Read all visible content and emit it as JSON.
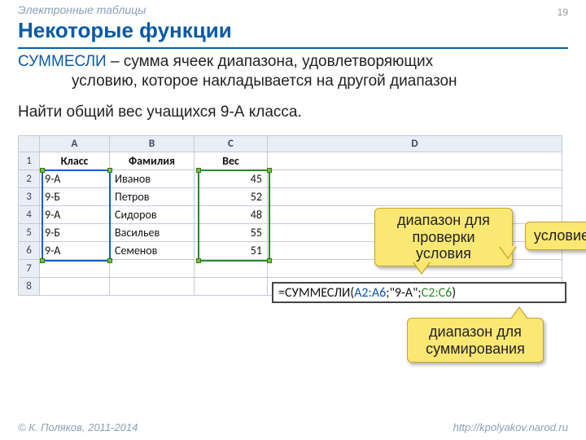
{
  "header": {
    "section": "Электронные таблицы",
    "page": "19"
  },
  "title": "Некоторые функции",
  "para1": {
    "func": "СУММЕСЛИ",
    "rest_line1": " – сумма ячеек диапазона, удовлетворяющих",
    "line2": "условию, которое накладывается на другой диапазон"
  },
  "para2": "Найти общий вес учащихся 9-А класса.",
  "spreadsheet": {
    "columns": [
      "A",
      "B",
      "C",
      "D"
    ],
    "headers": {
      "A": "Класс",
      "B": "Фамилия",
      "C": "Вес"
    },
    "rows": [
      {
        "n": "1"
      },
      {
        "n": "2",
        "A": "9-А",
        "B": "Иванов",
        "C": "45"
      },
      {
        "n": "3",
        "A": "9-Б",
        "B": "Петров",
        "C": "52"
      },
      {
        "n": "4",
        "A": "9-А",
        "B": "Сидоров",
        "C": "48"
      },
      {
        "n": "5",
        "A": "9-Б",
        "B": "Васильев",
        "C": "55"
      },
      {
        "n": "6",
        "A": "9-А",
        "B": "Семенов",
        "C": "51"
      },
      {
        "n": "7"
      },
      {
        "n": "8"
      }
    ]
  },
  "formula": {
    "eq": "=",
    "fn": "СУММЕСЛИ(",
    "range1": "A2:A6",
    "sep1": ";\"",
    "criteria": "9-А",
    "sep2": "\";",
    "range2": "C2:C6",
    "close": ")"
  },
  "callouts": {
    "range_check_l1": "диапазон для",
    "range_check_l2": "проверки",
    "range_check_l3": "условия",
    "criteria": "условие",
    "sum_l1": "диапазон для",
    "sum_l2": "суммирования"
  },
  "footer": {
    "left": "© К. Поляков, 2011-2014",
    "right": "http://kpolyakov.narod.ru"
  }
}
